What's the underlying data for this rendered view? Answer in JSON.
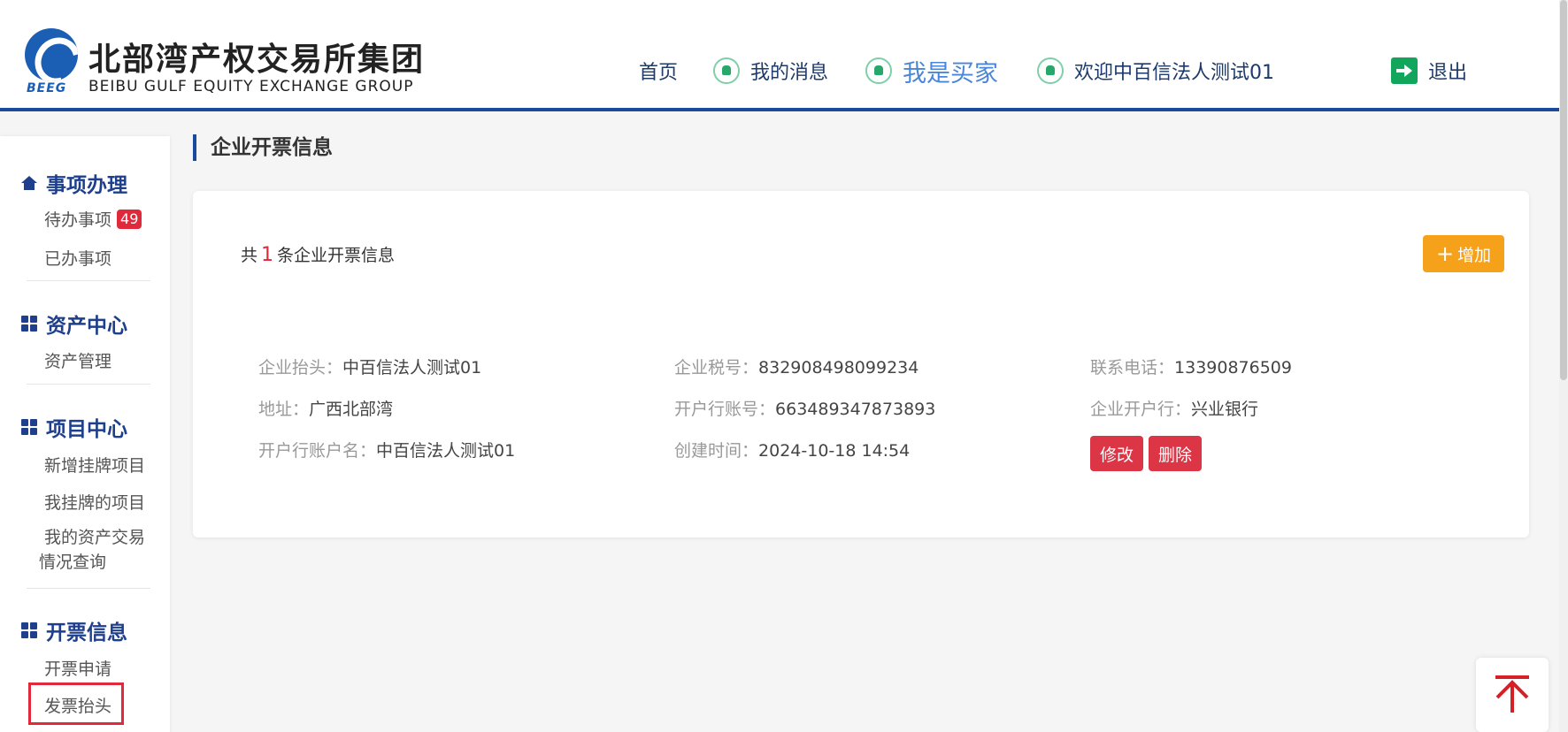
{
  "header": {
    "logo_cn": "北部湾产权交易所集团",
    "logo_en": "BEIBU GULF EQUITY EXCHANGE GROUP",
    "logo_abbr": "BEEG",
    "nav": {
      "home": "首页",
      "messages": "我的消息",
      "buyer": "我是买家",
      "welcome": "欢迎中百信法人测试01",
      "logout": "退出"
    }
  },
  "sidebar": {
    "sections": [
      {
        "title": "事项办理",
        "icon": "home-icon",
        "items": [
          {
            "label": "待办事项",
            "badge": "49"
          },
          {
            "label": "已办事项"
          }
        ]
      },
      {
        "title": "资产中心",
        "icon": "grid-icon",
        "items": [
          {
            "label": "资产管理"
          }
        ]
      },
      {
        "title": "项目中心",
        "icon": "grid-icon",
        "items": [
          {
            "label": "新增挂牌项目"
          },
          {
            "label": "我挂牌的项目"
          },
          {
            "label": "我的资产交易情况查询"
          }
        ]
      },
      {
        "title": "开票信息",
        "icon": "grid-icon",
        "items": [
          {
            "label": "开票申请"
          },
          {
            "label": "发票抬头"
          }
        ]
      }
    ]
  },
  "main": {
    "page_title": "企业开票信息",
    "count_prefix": "共",
    "count": "1",
    "count_suffix": "条企业开票信息",
    "add_button": "增加",
    "record": {
      "title_label": "企业抬头：",
      "title_value": "中百信法人测试01",
      "tax_label": "企业税号：",
      "tax_value": "832908498099234",
      "phone_label": "联系电话：",
      "phone_value": "13390876509",
      "address_label": "地址：",
      "address_value": "广西北部湾",
      "account_no_label": "开户行账号：",
      "account_no_value": "663489347873893",
      "bank_label": "企业开户行：",
      "bank_value": "兴业银行",
      "account_name_label": "开户行账户名：",
      "account_name_value": "中百信法人测试01",
      "created_label": "创建时间：",
      "created_value": "2024-10-18 14:54",
      "edit_button": "修改",
      "delete_button": "删除"
    }
  },
  "colors": {
    "brand_blue": "#1a4a9c",
    "accent_orange": "#f6a11a",
    "danger_red": "#dc3545",
    "highlight_red": "#e0293b"
  }
}
